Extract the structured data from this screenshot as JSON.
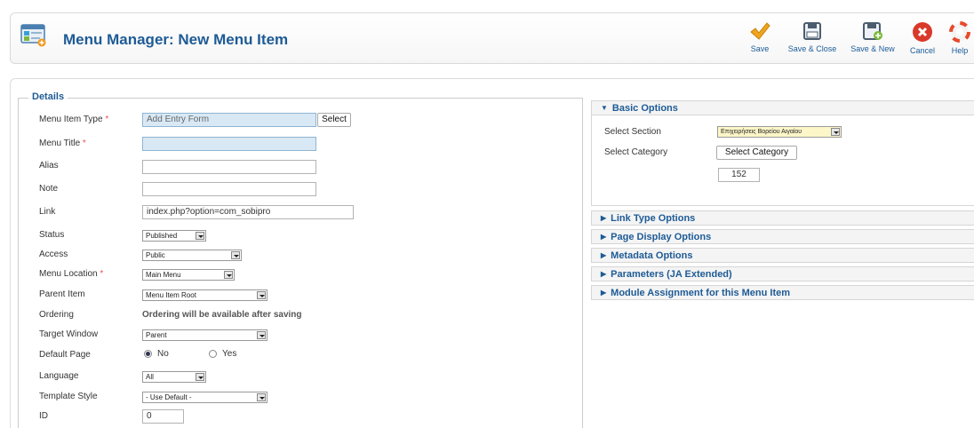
{
  "header": {
    "title": "Menu Manager: New Menu Item"
  },
  "toolbar": {
    "save": "Save",
    "save_close": "Save & Close",
    "save_new": "Save & New",
    "cancel": "Cancel",
    "help": "Help"
  },
  "details": {
    "legend": "Details",
    "menu_item_type": {
      "label": "Menu Item Type",
      "value": "Add Entry Form",
      "select_button": "Select"
    },
    "menu_title": {
      "label": "Menu Title",
      "value": ""
    },
    "alias": {
      "label": "Alias",
      "value": ""
    },
    "note": {
      "label": "Note",
      "value": ""
    },
    "link": {
      "label": "Link",
      "value": "index.php?option=com_sobipro"
    },
    "status": {
      "label": "Status",
      "value": "Published"
    },
    "access": {
      "label": "Access",
      "value": "Public"
    },
    "menu_location": {
      "label": "Menu Location",
      "value": "Main Menu"
    },
    "parent_item": {
      "label": "Parent Item",
      "value": "Menu Item Root"
    },
    "ordering": {
      "label": "Ordering",
      "value": "Ordering will be available after saving"
    },
    "target_window": {
      "label": "Target Window",
      "value": "Parent"
    },
    "default_page": {
      "label": "Default Page",
      "no": "No",
      "yes": "Yes",
      "selected": "No"
    },
    "language": {
      "label": "Language",
      "value": "All"
    },
    "template_style": {
      "label": "Template Style",
      "value": "- Use Default -"
    },
    "id": {
      "label": "ID",
      "value": "0"
    },
    "required_mark": "*"
  },
  "options": {
    "basic": {
      "title": "Basic Options",
      "select_section_label": "Select Section",
      "select_section_value": "Επιχειρήσεις Βορείου Αιγαίου",
      "select_category_label": "Select Category",
      "select_category_button": "Select Category",
      "category_id": "152"
    },
    "panels": [
      "Link Type Options",
      "Page Display Options",
      "Metadata Options",
      "Parameters (JA Extended)",
      "Module Assignment for this Menu Item"
    ]
  },
  "colors": {
    "accent": "#1e5b95",
    "save": "#f0a31c",
    "cancel": "#d9392a"
  },
  "icons": {
    "save": "checkmark-icon",
    "save_close": "floppy-icon",
    "save_new": "floppy-plus-icon",
    "cancel": "x-circle-icon",
    "help": "lifebuoy-icon"
  }
}
